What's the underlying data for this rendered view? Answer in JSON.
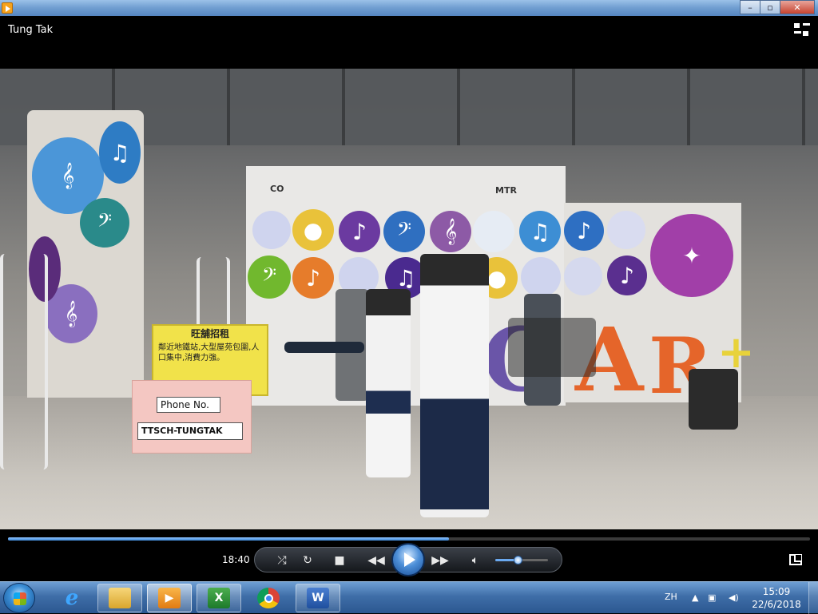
{
  "window": {
    "title": "Tung Tak",
    "buttons": {
      "minimize": "–",
      "maximize": "▫",
      "close": "✕"
    }
  },
  "video": {
    "sign_text": "旺舖招租 鄰近地鐵站，大型屋苑包圍，人口集中，消費力強",
    "sign_heading": "旺舖招租",
    "sign_body": "鄰近地鐵站,大型屋苑包圍,人口集中,消費力強。",
    "phone_label": "Phone No.",
    "phone_value": "TTSCH-TUNGTAK",
    "brand": "MTR",
    "banner_fragment": "CO"
  },
  "player": {
    "elapsed": "18:40",
    "progress": 0.55,
    "volume": 0.43,
    "icons": {
      "shuffle": "shuffle-icon",
      "repeat": "repeat-icon",
      "stop": "stop-icon",
      "previous": "previous-icon",
      "play": "play-icon",
      "next": "next-icon",
      "volume": "volume-icon",
      "switch_to_library": "switch-to-library-icon",
      "fullscreen": "fullscreen-icon"
    }
  },
  "taskbar": {
    "apps": [
      {
        "name": "Internet Explorer",
        "icon": "ie-icon",
        "state": "plain"
      },
      {
        "name": "Windows Explorer",
        "icon": "folder-icon",
        "state": "pinned"
      },
      {
        "name": "Windows Media Player",
        "icon": "media-player-icon",
        "state": "active"
      },
      {
        "name": "Excel",
        "icon": "excel-icon",
        "state": "pinned"
      },
      {
        "name": "Chrome",
        "icon": "chrome-icon",
        "state": "plain"
      },
      {
        "name": "Word",
        "icon": "word-icon",
        "state": "pinned"
      }
    ],
    "language": "ZH",
    "clock_time": "15:09",
    "clock_date": "22/6/2018"
  },
  "colors": {
    "taskbar": "#3f6ea8",
    "seek_fill": "#3c86d6",
    "sign_yellow": "#f1e24a",
    "card_pink": "#f4c7c2"
  }
}
